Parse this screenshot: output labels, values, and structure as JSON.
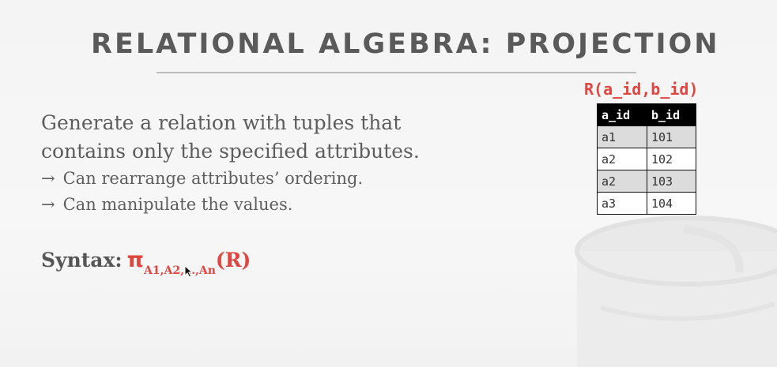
{
  "slide": {
    "title": "RELATIONAL ALGEBRA: PROJECTION",
    "description": {
      "line1": "Generate a relation with tuples that",
      "line2": "contains only the specified attributes.",
      "bullets": [
        {
          "arrow": "→",
          "text": "Can rearrange attributes’ ordering."
        },
        {
          "arrow": "→",
          "text": "Can manipulate the values."
        }
      ]
    },
    "syntax": {
      "label": "Syntax:",
      "operator": "π",
      "subscript": "A1,A2,…,An",
      "argument": "(R)"
    }
  },
  "relation": {
    "title": "R(a_id,b_id)",
    "columns": [
      "a_id",
      "b_id"
    ],
    "rows": [
      [
        "a1",
        "101"
      ],
      [
        "a2",
        "102"
      ],
      [
        "a2",
        "103"
      ],
      [
        "a3",
        "104"
      ]
    ]
  },
  "colors": {
    "accent": "#e0463f",
    "title": "#5a5a5a",
    "text": "#5d5d5d",
    "table_header": "#000000",
    "table_alt_row": "#dcdcdc"
  }
}
